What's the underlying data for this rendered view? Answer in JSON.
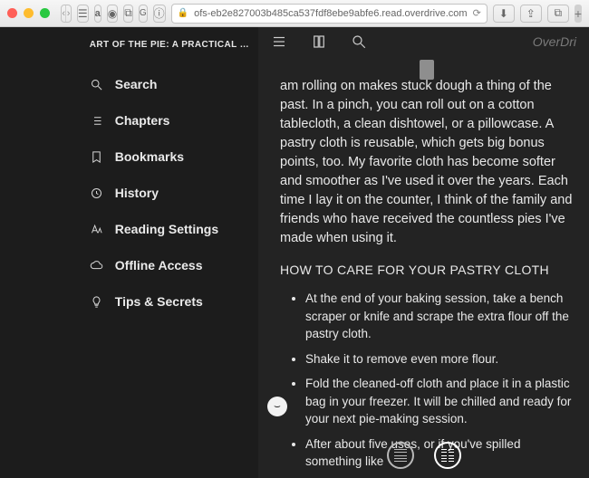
{
  "browser": {
    "url": "ofs-eb2e827003b485ca537fdf8ebe9abfe6.read.overdrive.com"
  },
  "brand": "OverDri",
  "book_title": "ART OF THE PIE: A PRACTICAL …",
  "sidebar": {
    "items": [
      {
        "label": "Search"
      },
      {
        "label": "Chapters"
      },
      {
        "label": "Bookmarks"
      },
      {
        "label": "History"
      },
      {
        "label": "Reading Settings"
      },
      {
        "label": "Offline Access"
      },
      {
        "label": "Tips & Secrets"
      }
    ]
  },
  "reader": {
    "paragraph": "am rolling on makes stuck dough a thing of the past. In a pinch, you can roll out on a cotton tablecloth, a clean dishtowel, or a pillowcase. A pastry cloth is reusable, which gets big bonus points, too. My favorite cloth has become softer and smoother as I've used it over the years. Each time I lay it on the counter, I think of the family and friends who have received the countless pies I've made when using it.",
    "heading": "HOW TO CARE FOR YOUR PASTRY CLOTH",
    "bullets": [
      "At the end of your baking session, take a bench scraper or knife and scrape the extra flour off the pastry cloth.",
      "Shake it to remove even more flour.",
      "Fold the cleaned-off cloth and place it in a plastic bag in your freezer. It will be chilled and ready for your next pie-making session.",
      "After about five uses, or if you've spilled something like"
    ]
  }
}
